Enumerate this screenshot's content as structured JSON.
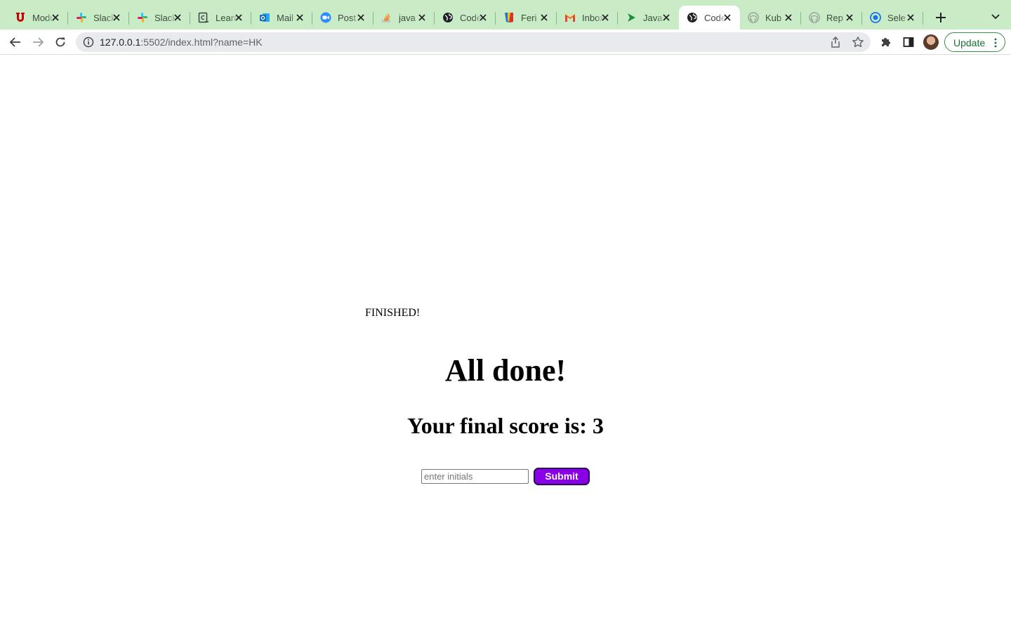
{
  "browser": {
    "tabs": [
      {
        "title": "Modules",
        "icon": "utah-u-icon",
        "color": "#cc0000"
      },
      {
        "title": "Slack",
        "icon": "slack-icon",
        "color": "#e01e5a"
      },
      {
        "title": "Slack",
        "icon": "slack-icon",
        "color": "#e01e5a"
      },
      {
        "title": "Learn",
        "icon": "learn-icon",
        "color": "#3c4043"
      },
      {
        "title": "Mail",
        "icon": "outlook-icon",
        "color": "#0f6cbd"
      },
      {
        "title": "Post",
        "icon": "zoom-icon",
        "color": "#2d8cff"
      },
      {
        "title": "java",
        "icon": "stackoverflow-icon",
        "color": "#f48024"
      },
      {
        "title": "Code",
        "icon": "globe-icon",
        "color": "#202124"
      },
      {
        "title": "Feri",
        "icon": "feri-icon",
        "color": "#d93025"
      },
      {
        "title": "Inbox",
        "icon": "gmail-icon",
        "color": "#ea4335"
      },
      {
        "title": "Java",
        "icon": "play-icon",
        "color": "#1e8e3e"
      },
      {
        "title": "Code",
        "icon": "globe-icon",
        "color": "#202124",
        "active": true
      },
      {
        "title": "Kub",
        "icon": "github-icon",
        "color": "#9aa59a"
      },
      {
        "title": "Rep",
        "icon": "github-icon",
        "color": "#9aa59a"
      },
      {
        "title": "Sele",
        "icon": "selenium-icon",
        "color": "#1a73e8"
      }
    ],
    "url_host": "127.0.0.1",
    "url_rest": ":5502/index.html?name=HK",
    "update_label": "Update"
  },
  "page": {
    "status_text": "FINISHED!",
    "heading": "All done!",
    "score_text": "Your final score is: 3",
    "initials_placeholder": "enter initials",
    "initials_value": "",
    "submit_label": "Submit"
  },
  "colors": {
    "tabstrip_bg": "#c9ecc6",
    "submit_bg": "#8a00e6",
    "submit_border": "#2b0055"
  }
}
